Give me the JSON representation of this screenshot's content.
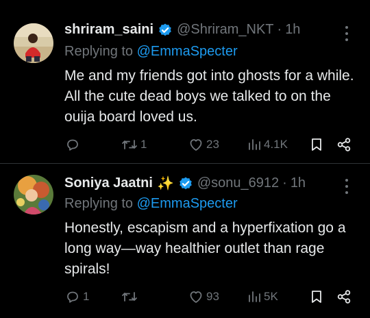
{
  "colors": {
    "background": "#000000",
    "text": "#e7e9ea",
    "muted": "#71767b",
    "link": "#1d9bf0",
    "divider": "#2f3336"
  },
  "replies": [
    {
      "display_name": "shriram_saini",
      "verified_icon": "verified-badge-icon",
      "handle": "@Shriram_NKT",
      "separator": "·",
      "time": "1h",
      "replying_prefix": "Replying to",
      "replying_to": "@EmmaSpecter",
      "text": "Me and my friends got into ghosts for a while. All the cute dead boys we talked to on the ouija board loved us.",
      "stats": {
        "replies": "",
        "reposts": "1",
        "likes": "23",
        "views": "4.1K"
      }
    },
    {
      "display_name": "Soniya Jaatni",
      "emoji": "✨",
      "verified_icon": "verified-badge-icon",
      "handle": "@sonu_6912",
      "separator": "·",
      "time": "1h",
      "replying_prefix": "Replying to",
      "replying_to": "@EmmaSpecter",
      "text": "Honestly, escapism and a hyperfixation go a long way—way healthier outlet than rage spirals!",
      "stats": {
        "replies": "1",
        "reposts": "",
        "likes": "93",
        "views": "5K"
      }
    }
  ]
}
